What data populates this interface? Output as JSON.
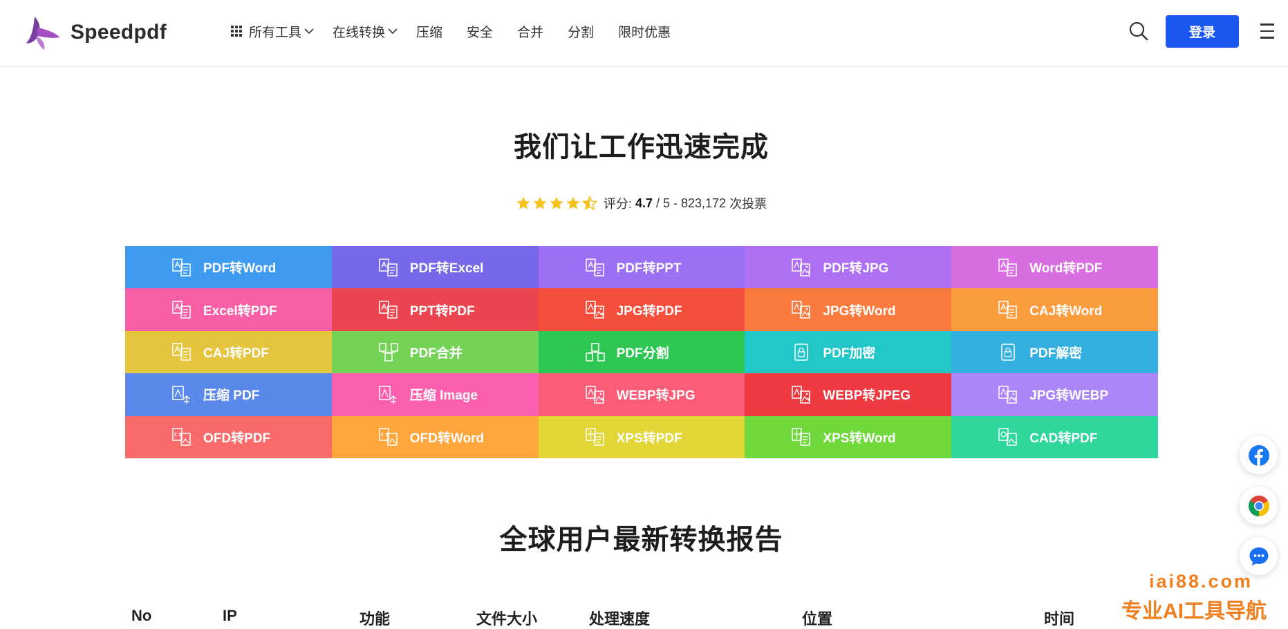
{
  "header": {
    "logo_text": "Speedpdf",
    "nav": [
      {
        "label": "所有工具",
        "has_grid_icon": true,
        "has_chevron": true
      },
      {
        "label": "在线转换",
        "has_chevron": true
      },
      {
        "label": "压缩"
      },
      {
        "label": "安全"
      },
      {
        "label": "合并"
      },
      {
        "label": "分割"
      },
      {
        "label": "限时优惠"
      }
    ],
    "login_label": "登录",
    "search_icon": "search-icon",
    "menu_icon": "hamburger-menu-icon"
  },
  "hero": {
    "title": "我们让工作迅速完成",
    "rating_prefix": "评分: ",
    "rating_value": "4.7",
    "rating_suffix": " / 5 - ",
    "votes": "823,172",
    "votes_suffix": " 次投票",
    "stars": 4.5,
    "star_color": "#f7c21b"
  },
  "tools": [
    {
      "label": "PDF转Word",
      "color": "#3f9bf0",
      "icon": "pdf-doc-icon"
    },
    {
      "label": "PDF转Excel",
      "color": "#7668e8",
      "icon": "pdf-sheet-icon"
    },
    {
      "label": "PDF转PPT",
      "color": "#9b70f4",
      "icon": "pdf-slide-icon"
    },
    {
      "label": "PDF转JPG",
      "color": "#ad70f2",
      "icon": "pdf-image-icon"
    },
    {
      "label": "Word转PDF",
      "color": "#d96ee2",
      "icon": "word-doc-icon"
    },
    {
      "label": "Excel转PDF",
      "color": "#f95fa4",
      "icon": "excel-sheet-icon"
    },
    {
      "label": "PPT转PDF",
      "color": "#eb4650",
      "icon": "ppt-slide-icon"
    },
    {
      "label": "JPG转PDF",
      "color": "#f54e3c",
      "icon": "jpg-image-icon"
    },
    {
      "label": "JPG转Word",
      "color": "#fb7a3e",
      "icon": "jpg-doc-icon"
    },
    {
      "label": "CAJ转Word",
      "color": "#fb9c3e",
      "icon": "caj-doc-icon"
    },
    {
      "label": "CAJ转PDF",
      "color": "#e6c53e",
      "icon": "caj-pdf-icon"
    },
    {
      "label": "PDF合并",
      "color": "#74d356",
      "icon": "merge-icon"
    },
    {
      "label": "PDF分割",
      "color": "#2ec754",
      "icon": "split-icon"
    },
    {
      "label": "PDF加密",
      "color": "#22c7c8",
      "icon": "lock-icon"
    },
    {
      "label": "PDF解密",
      "color": "#33b0e0",
      "icon": "unlock-icon"
    },
    {
      "label": "压缩 PDF",
      "color": "#5b89eb",
      "icon": "compress-pdf-icon"
    },
    {
      "label": "压缩 Image",
      "color": "#fb5fad",
      "icon": "compress-image-icon"
    },
    {
      "label": "WEBP转JPG",
      "color": "#fb5c77",
      "icon": "webp-jpg-icon"
    },
    {
      "label": "WEBP转JPEG",
      "color": "#ef3a42",
      "icon": "webp-jpeg-icon"
    },
    {
      "label": "JPG转WEBP",
      "color": "#ab86f7",
      "icon": "jpg-webp-icon"
    },
    {
      "label": "OFD转PDF",
      "color": "#f96a6a",
      "icon": "ofd-pdf-icon"
    },
    {
      "label": "OFD转Word",
      "color": "#fda63c",
      "icon": "ofd-word-icon"
    },
    {
      "label": "XPS转PDF",
      "color": "#e1d635",
      "icon": "xps-pdf-icon"
    },
    {
      "label": "XPS转Word",
      "color": "#6fd83b",
      "icon": "xps-word-icon"
    },
    {
      "label": "CAD转PDF",
      "color": "#2fd69c",
      "icon": "cad-pdf-icon"
    }
  ],
  "report": {
    "title": "全球用户最新转换报告",
    "columns": [
      "No",
      "IP",
      "功能",
      "文件大小",
      "处理速度",
      "位置",
      "时间"
    ]
  },
  "side_buttons": [
    {
      "icon": "facebook-icon",
      "color": "#1877f2"
    },
    {
      "icon": "chrome-icon"
    },
    {
      "icon": "chat-icon",
      "color": "#1a6ef0"
    }
  ],
  "watermark": {
    "url": "iai88.com",
    "text": "专业AI工具导航",
    "color": "#f07f1f"
  }
}
